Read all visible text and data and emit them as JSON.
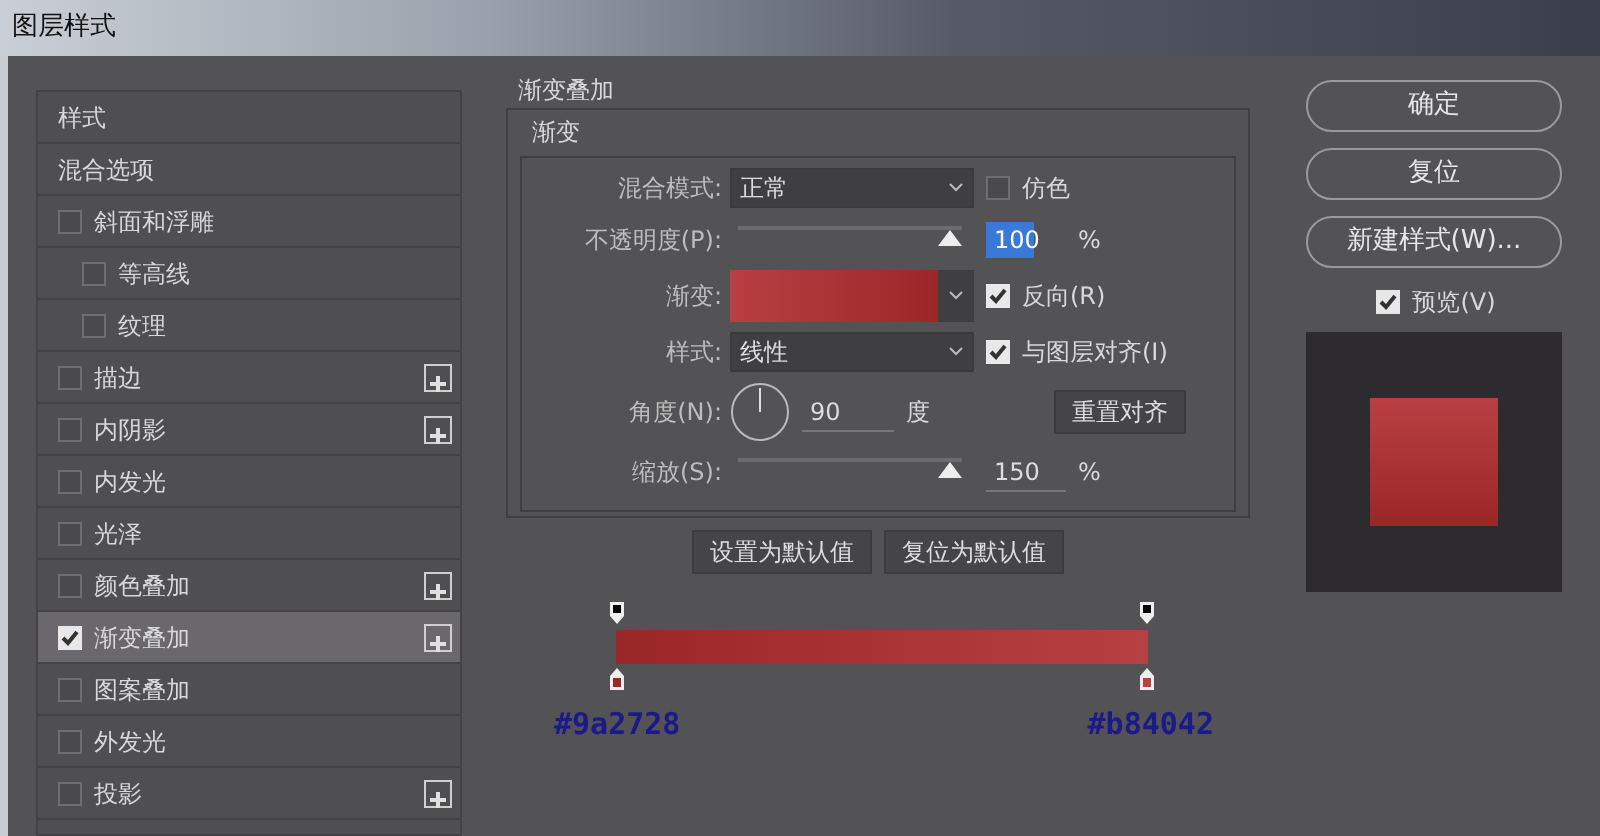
{
  "window": {
    "title": "图层样式"
  },
  "sidebar": {
    "items": [
      {
        "kind": "header",
        "label": "样式",
        "selected": false
      },
      {
        "kind": "header",
        "label": "混合选项",
        "selected": false
      },
      {
        "kind": "check",
        "label": "斜面和浮雕",
        "checked": false,
        "selected": false,
        "addable": false,
        "children": [
          {
            "kind": "check",
            "label": "等高线",
            "checked": false,
            "selected": false,
            "addable": false
          },
          {
            "kind": "check",
            "label": "纹理",
            "checked": false,
            "selected": false,
            "addable": false
          }
        ]
      },
      {
        "kind": "check",
        "label": "描边",
        "checked": false,
        "selected": false,
        "addable": true
      },
      {
        "kind": "check",
        "label": "内阴影",
        "checked": false,
        "selected": false,
        "addable": true
      },
      {
        "kind": "check",
        "label": "内发光",
        "checked": false,
        "selected": false,
        "addable": false
      },
      {
        "kind": "check",
        "label": "光泽",
        "checked": false,
        "selected": false,
        "addable": false
      },
      {
        "kind": "check",
        "label": "颜色叠加",
        "checked": false,
        "selected": false,
        "addable": true
      },
      {
        "kind": "check",
        "label": "渐变叠加",
        "checked": true,
        "selected": true,
        "addable": true
      },
      {
        "kind": "check",
        "label": "图案叠加",
        "checked": false,
        "selected": false,
        "addable": false
      },
      {
        "kind": "check",
        "label": "外发光",
        "checked": false,
        "selected": false,
        "addable": false
      },
      {
        "kind": "check",
        "label": "投影",
        "checked": false,
        "selected": false,
        "addable": true
      }
    ]
  },
  "panel": {
    "title": "渐变叠加",
    "group": "渐变",
    "blend_mode": {
      "label": "混合模式:",
      "value": "正常"
    },
    "dither": {
      "label": "仿色",
      "checked": false
    },
    "opacity": {
      "label": "不透明度(P):",
      "level": 1.0,
      "value": "100",
      "unit": "%"
    },
    "gradient": {
      "label": "渐变:"
    },
    "reverse": {
      "label": "反向(R)",
      "checked": true
    },
    "style": {
      "label": "样式:",
      "value": "线性"
    },
    "align": {
      "label": "与图层对齐(I)",
      "checked": true
    },
    "angle": {
      "label": "角度(N):",
      "value": "90",
      "unit": "度",
      "reset_button": "重置对齐"
    },
    "scale": {
      "label": "缩放(S):",
      "level": 1.0,
      "value": "150",
      "unit": "%"
    },
    "buttons": [
      "设置为默认值",
      "复位为默认值"
    ],
    "stops": [
      {
        "color": "#9a2728",
        "label": "#9a2728"
      },
      {
        "color": "#b84042",
        "label": "#b84042"
      }
    ]
  },
  "actions": {
    "buttons": [
      "确定",
      "复位",
      "新建样式(W)..."
    ],
    "preview": {
      "label": "预览(V)",
      "checked": true
    }
  }
}
